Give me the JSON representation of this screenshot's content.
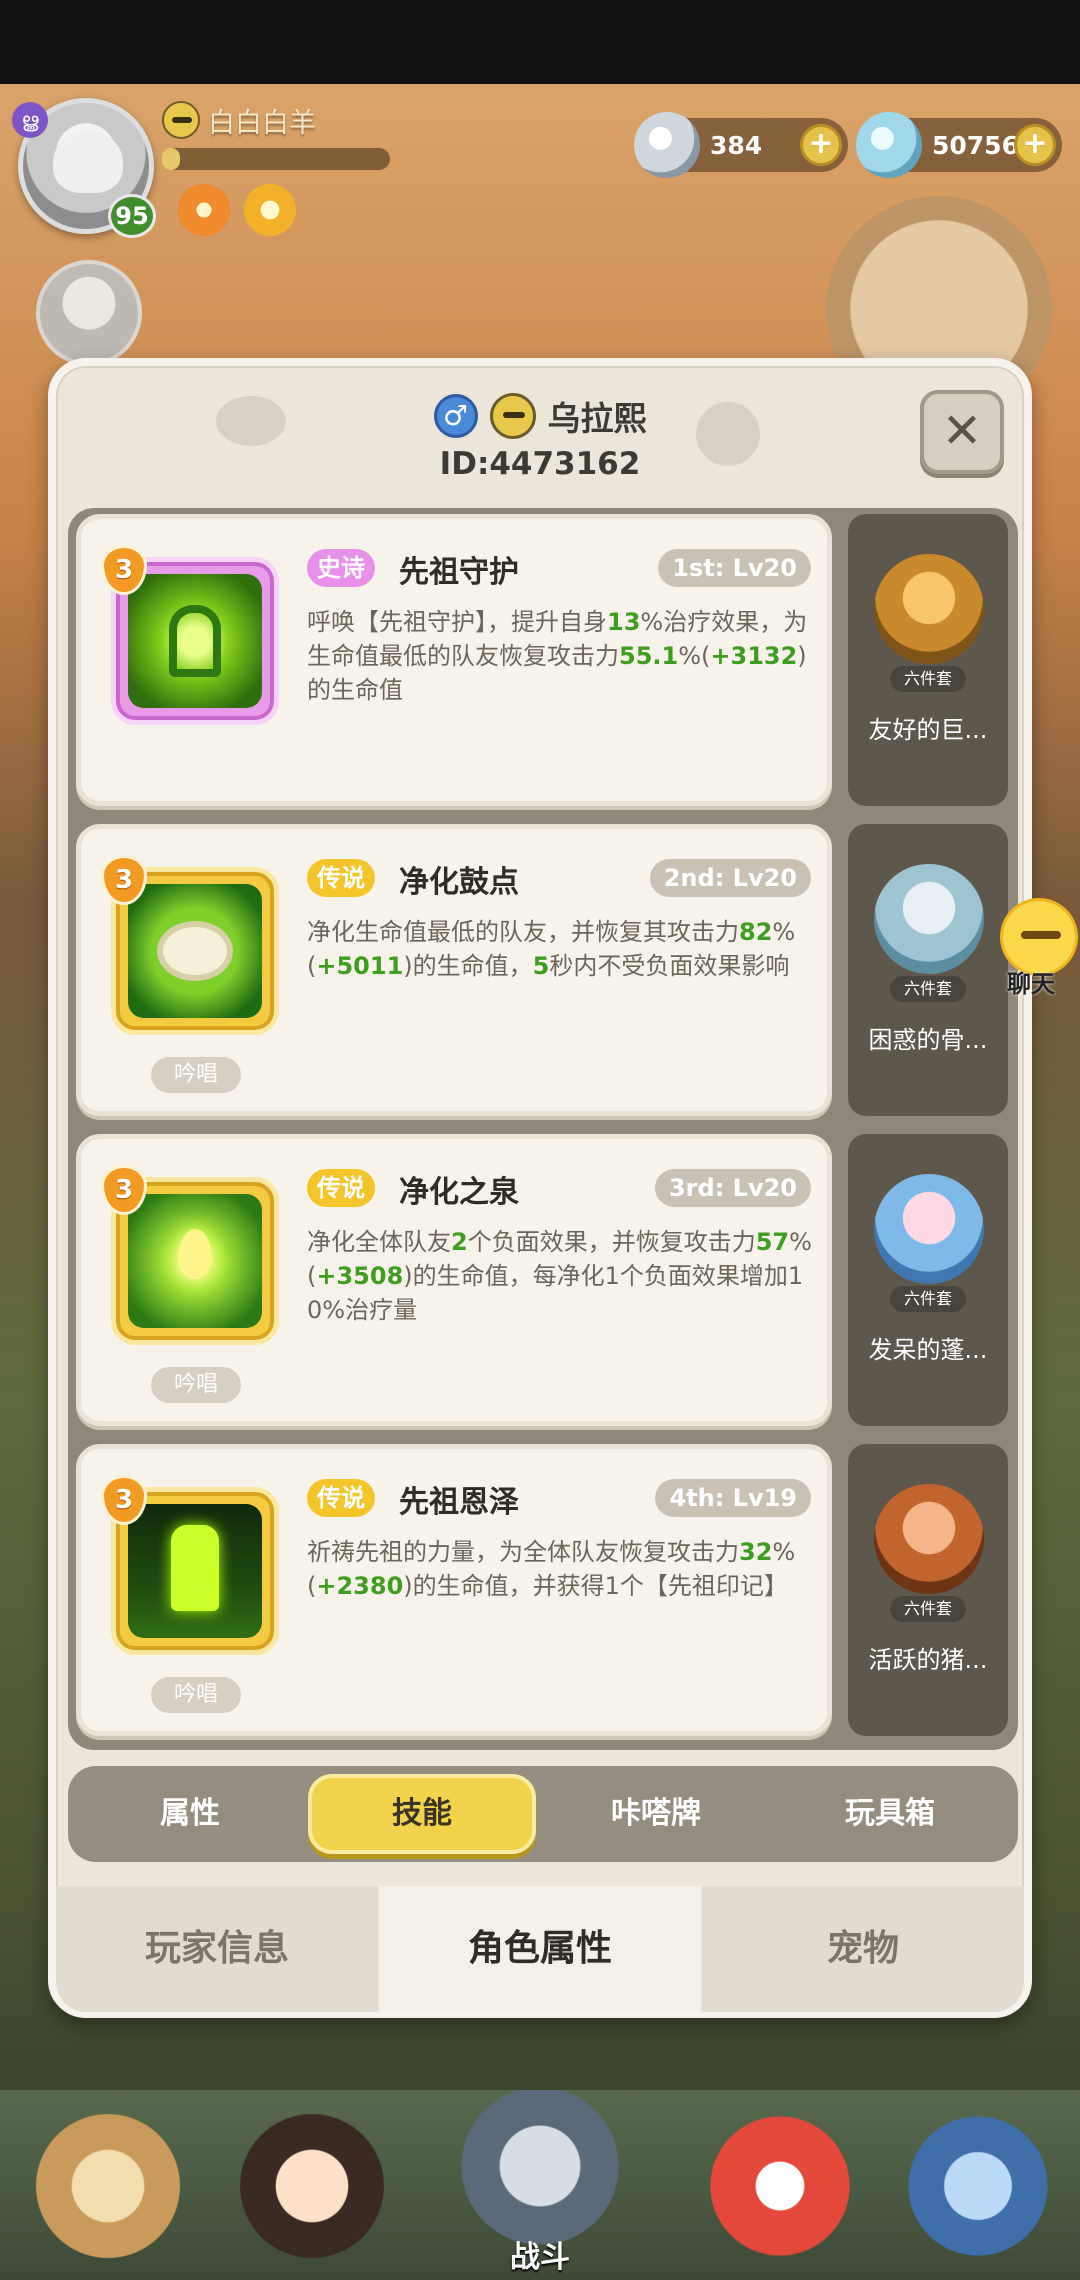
{
  "hud": {
    "player_name": "白白白羊",
    "level": "95",
    "exp_fraction": 0.08,
    "currency": [
      {
        "icon": "silver-shell-icon",
        "value": "384"
      },
      {
        "icon": "blue-gem-icon",
        "value": "507567"
      }
    ],
    "plus_symbol": "+"
  },
  "panel": {
    "gender_symbol": "♂",
    "character_name": "乌拉熙",
    "character_id": "ID:4473162",
    "close_symbol": "✕"
  },
  "skills": [
    {
      "rarity": "史诗",
      "rarity_type": "epic",
      "name": "先祖守护",
      "level": "1st: Lv20",
      "upgrade": "3",
      "chant": "",
      "desc": [
        {
          "t": "呼唤【先祖守护】，提升自身"
        },
        {
          "t": "13",
          "g": true
        },
        {
          "t": "%治疗效果，为生命值最低的队友恢复攻击力"
        },
        {
          "t": "55.1",
          "g": true
        },
        {
          "t": "%("
        },
        {
          "t": "+3132",
          "g": true
        },
        {
          "t": ")的生命值"
        }
      ]
    },
    {
      "rarity": "传说",
      "rarity_type": "legend",
      "name": "净化鼓点",
      "level": "2nd: Lv20",
      "upgrade": "3",
      "chant": "吟唱",
      "desc": [
        {
          "t": "净化生命值最低的队友，并恢复其攻击力"
        },
        {
          "t": "82",
          "g": true
        },
        {
          "t": "%("
        },
        {
          "t": "+5011",
          "g": true
        },
        {
          "t": ")的生命值，"
        },
        {
          "t": "5",
          "g": true
        },
        {
          "t": "秒内不受负面效果影响"
        }
      ]
    },
    {
      "rarity": "传说",
      "rarity_type": "legend",
      "name": "净化之泉",
      "level": "3rd: Lv20",
      "upgrade": "3",
      "chant": "吟唱",
      "desc": [
        {
          "t": "净化全体队友"
        },
        {
          "t": "2",
          "g": true
        },
        {
          "t": "个负面效果，并恢复攻击力"
        },
        {
          "t": "57",
          "g": true
        },
        {
          "t": "%("
        },
        {
          "t": "+3508",
          "g": true
        },
        {
          "t": ")的生命值，每净化1个负面效果增加10%治疗量"
        }
      ]
    },
    {
      "rarity": "传说",
      "rarity_type": "legend",
      "name": "先祖恩泽",
      "level": "4th: Lv19",
      "upgrade": "3",
      "chant": "吟唱",
      "desc": [
        {
          "t": "祈祷先祖的力量，为全体队友恢复攻击力"
        },
        {
          "t": "32",
          "g": true
        },
        {
          "t": "%("
        },
        {
          "t": "+2380",
          "g": true
        },
        {
          "t": ")的生命值，并获得1个【先祖印记】"
        }
      ]
    }
  ],
  "sets": [
    {
      "tag": "六件套",
      "name": "友好的巨..."
    },
    {
      "tag": "六件套",
      "name": "困惑的骨..."
    },
    {
      "tag": "六件套",
      "name": "发呆的蓬..."
    },
    {
      "tag": "六件套",
      "name": "活跃的猪..."
    }
  ],
  "tabs": [
    "属性",
    "技能",
    "咔嗒牌",
    "玩具箱"
  ],
  "active_tab": 1,
  "bottom_tabs": [
    "玩家信息",
    "角色属性",
    "宠物"
  ],
  "active_bottom_tab": 1,
  "chat": {
    "label": "聊天"
  },
  "nav": {
    "battle_label": "战斗"
  }
}
